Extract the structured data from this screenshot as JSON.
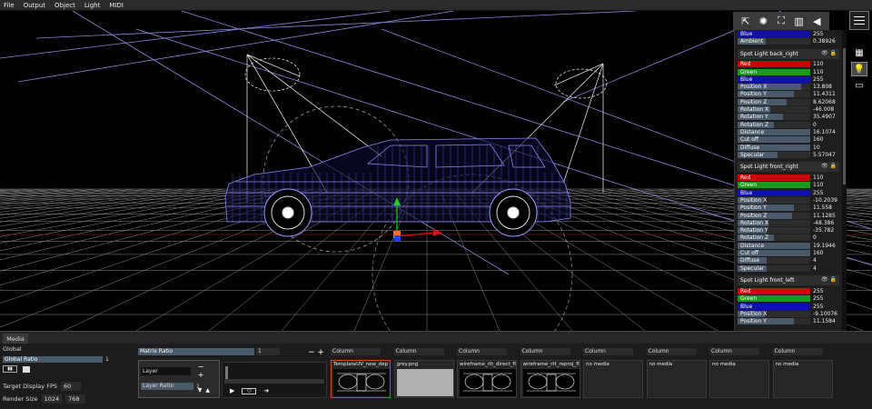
{
  "menu": [
    "File",
    "Output",
    "Object",
    "Light",
    "MIDI"
  ],
  "toolbar": {
    "icons": [
      "select-arrow-icon",
      "gear-circle-icon",
      "transform-frame-icon",
      "split-view-icon",
      "triangle-icon"
    ],
    "glyphs": [
      "⇱",
      "✺",
      "⛶",
      "▥",
      "◀"
    ]
  },
  "side_icons": {
    "glyphs": [
      "▦",
      "💡",
      "▭"
    ]
  },
  "props": {
    "top_rows": [
      {
        "label": "Blue",
        "value": "255",
        "style": "blue"
      },
      {
        "label": "Ambient",
        "value": "0.38926",
        "style": "plain",
        "fill": 0.39
      }
    ],
    "sections": [
      {
        "title": "Spot Light back_right",
        "rows": [
          {
            "label": "Red",
            "value": "110",
            "style": "red"
          },
          {
            "label": "Green",
            "value": "110",
            "style": "green"
          },
          {
            "label": "Blue",
            "value": "255",
            "style": "blue"
          },
          {
            "label": "Position X",
            "value": "13.808",
            "style": "plain",
            "fill": 0.88
          },
          {
            "label": "Position Y",
            "value": "11.4311",
            "style": "plain",
            "fill": 0.78
          },
          {
            "label": "Position Z",
            "value": "8.62068",
            "style": "plain",
            "fill": 0.68
          },
          {
            "label": "Rotation X",
            "value": "-46.008",
            "style": "plain",
            "fill": 0.45
          },
          {
            "label": "Rotation Y",
            "value": "35.4907",
            "style": "plain",
            "fill": 0.62
          },
          {
            "label": "Rotation Z",
            "value": "0",
            "style": "plain",
            "fill": 0.5
          },
          {
            "label": "Distance",
            "value": "16.1074",
            "style": "plain",
            "fill": 1.0
          },
          {
            "label": "Cut off",
            "value": "160",
            "style": "plain",
            "fill": 1.0
          },
          {
            "label": "Diffuse",
            "value": "10",
            "style": "plain",
            "fill": 1.0
          },
          {
            "label": "Specular",
            "value": "5.57047",
            "style": "plain",
            "fill": 0.55
          }
        ]
      },
      {
        "title": "Spot Light front_right",
        "rows": [
          {
            "label": "Red",
            "value": "110",
            "style": "red"
          },
          {
            "label": "Green",
            "value": "110",
            "style": "green"
          },
          {
            "label": "Blue",
            "value": "255",
            "style": "blue"
          },
          {
            "label": "Position X",
            "value": "-10.2039",
            "style": "plain",
            "fill": 0.36
          },
          {
            "label": "Position Y",
            "value": "11.558",
            "style": "plain",
            "fill": 0.78
          },
          {
            "label": "Position Z",
            "value": "11.1285",
            "style": "plain",
            "fill": 0.75
          },
          {
            "label": "Rotation X",
            "value": "-48.386",
            "style": "plain",
            "fill": 0.43
          },
          {
            "label": "Rotation Y",
            "value": "-35.782",
            "style": "plain",
            "fill": 0.4
          },
          {
            "label": "Rotation Z",
            "value": "0",
            "style": "plain",
            "fill": 0.5
          },
          {
            "label": "Distance",
            "value": "19.1946",
            "style": "plain",
            "fill": 1.0
          },
          {
            "label": "Cut off",
            "value": "160",
            "style": "plain",
            "fill": 1.0
          },
          {
            "label": "Diffuse",
            "value": "4",
            "style": "plain",
            "fill": 0.4
          },
          {
            "label": "Specular",
            "value": "4",
            "style": "plain",
            "fill": 0.4
          }
        ]
      },
      {
        "title": "Spot Light front_left",
        "rows": [
          {
            "label": "Red",
            "value": "255",
            "style": "red"
          },
          {
            "label": "Green",
            "value": "255",
            "style": "green"
          },
          {
            "label": "Blue",
            "value": "255",
            "style": "blue"
          },
          {
            "label": "Position X",
            "value": "-9.10076",
            "style": "plain",
            "fill": 0.38
          },
          {
            "label": "Position Y",
            "value": "11.1584",
            "style": "plain",
            "fill": 0.77
          }
        ]
      }
    ]
  },
  "bottom": {
    "tab": "Media",
    "global": {
      "label": "Global",
      "ratio_label": "Global Ratio",
      "ratio_value": "1",
      "toggle_glyph": "▮▮",
      "fps_label": "Target Display FPS",
      "fps_value": "60",
      "render_label": "Render Size",
      "render_w": "1024",
      "render_h": "768"
    },
    "matrix": {
      "label": "Matrix Ratio",
      "value": "1",
      "controls": "−  +"
    },
    "layer": {
      "name": "Layer",
      "buttons": "−+",
      "ratio_label": "Layer Ratio",
      "ratio_value": "1",
      "arrows": "▼▲"
    },
    "transport": {
      "play": "▶",
      "loop": "○",
      "next": "➔"
    },
    "columns": [
      {
        "header": "Column",
        "clip": "TemplateUV_new_dep",
        "thumb": "wire-dark",
        "selected": true
      },
      {
        "header": "Column",
        "clip": "grey.png",
        "thumb": "grey"
      },
      {
        "header": "Column",
        "clip": "wireframe_rtt_direct_fl",
        "thumb": "wire"
      },
      {
        "header": "Column",
        "clip": "wireframe_rtt_reproj_fl",
        "thumb": "wire"
      },
      {
        "header": "Column",
        "clip": "no media",
        "thumb": "none"
      },
      {
        "header": "Column",
        "clip": "no media",
        "thumb": "none"
      },
      {
        "header": "Column",
        "clip": "no media",
        "thumb": "none"
      },
      {
        "header": "Column",
        "clip": "no media",
        "thumb": "none"
      }
    ]
  },
  "colors": {
    "grid": "#c0c0c0",
    "car_wire": "#8888ff",
    "light_cone": "#9999ee",
    "axis_x": "#e01010",
    "axis_y": "#20d020",
    "axis_z": "#2040ff"
  }
}
